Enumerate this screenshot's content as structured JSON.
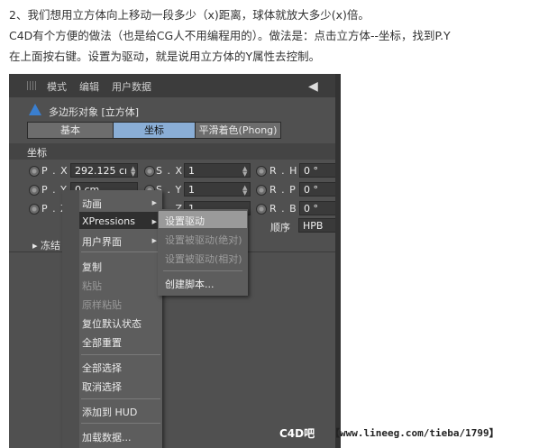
{
  "article": {
    "line1": "2、我们想用立方体向上移动一段多少（x)距离，球体就放大多少(x)倍。",
    "line2": "C4D有个方便的做法（也是给CG人不用编程用的）。做法是：点击立方体--坐标，找到P.Y",
    "line3": "在上面按右键。设置为驱动，就是说用立方体的Y属性去控制。"
  },
  "menubar": {
    "mode": "模式",
    "edit": "编辑",
    "userdata": "用户数据"
  },
  "object": {
    "title": "多边形对象 [立方体]"
  },
  "tabs": {
    "basic": "基本",
    "coord": "坐标",
    "phong": "平滑着色(Phong)"
  },
  "section": {
    "title": "坐标"
  },
  "params": {
    "px_label": "P . X",
    "px_value": "292.125 cı",
    "sx_label": "S . X",
    "sx_value": "1",
    "rh_label": "R . H",
    "rh_value": "0 °",
    "py_label": "P . Y",
    "py_value": "0 cm",
    "sy_label": "S . Y",
    "sy_value": "1",
    "rp_label": "R . P",
    "rp_value": "0 °",
    "pz_label": "P . Z",
    "sz_label": "S . Z",
    "sz_value": "1",
    "rb_label": "R . B",
    "rb_value": "0 °",
    "order_label": "顺序",
    "order_value": "HPB",
    "freeze_label": "冻结"
  },
  "context_menu": {
    "items": [
      "动画",
      "XPressions",
      "用户界面",
      "复制",
      "粘贴",
      "原样粘贴",
      "复位默认状态",
      "全部重置",
      "全部选择",
      "取消选择",
      "添加到 HUD",
      "加载数据..."
    ]
  },
  "submenu": {
    "items": [
      "设置驱动",
      "设置被驱动(绝对)",
      "设置被驱动(相对)",
      "创建脚本..."
    ]
  },
  "watermark": {
    "logo": "C4D吧",
    "url": "【www.lineeg.com/tieba/1799】"
  }
}
